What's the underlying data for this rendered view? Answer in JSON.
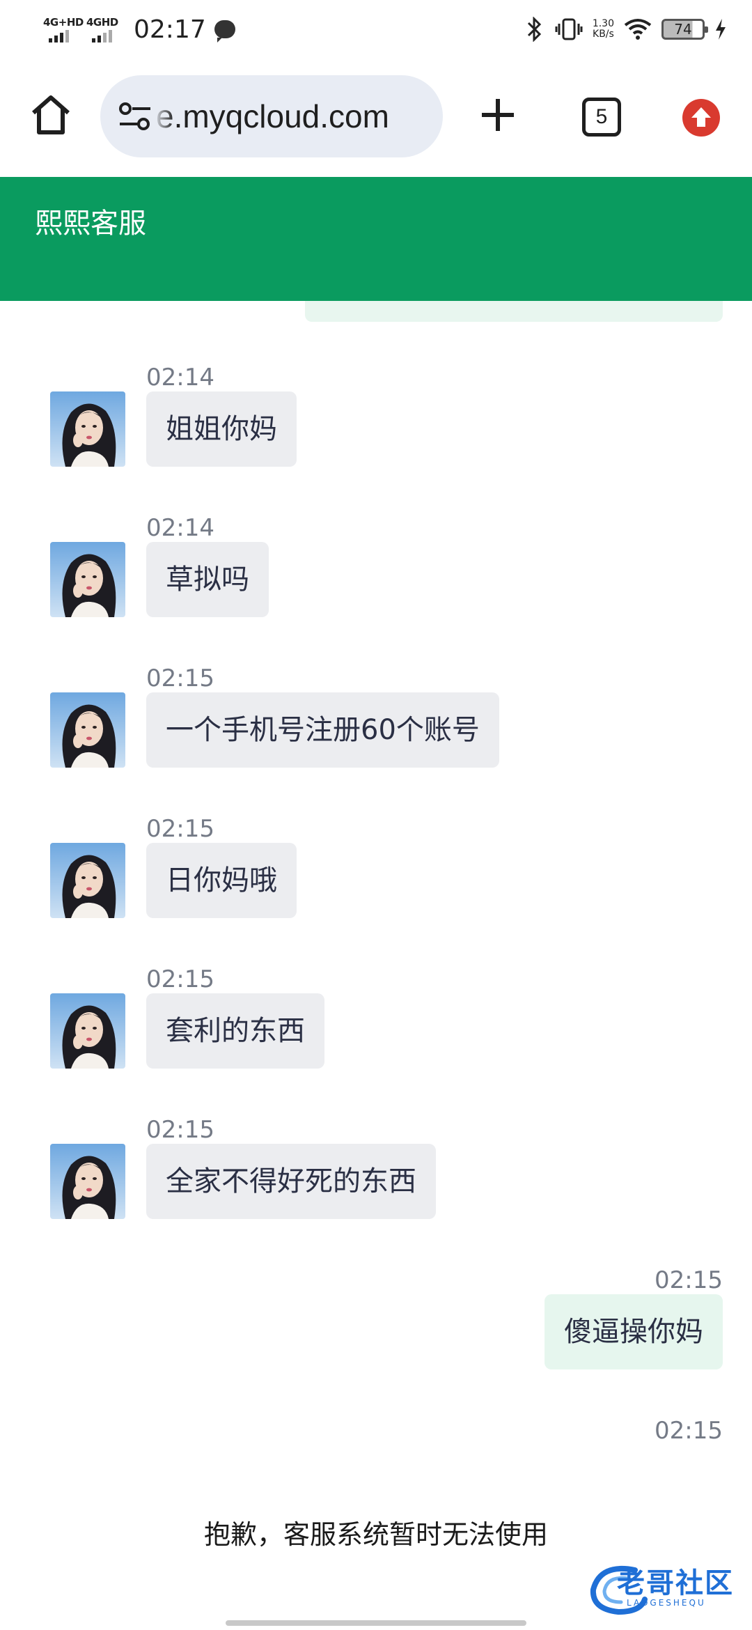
{
  "status_bar": {
    "net1": "4G+HD",
    "net2": "4GHD",
    "time": "02:17",
    "speed_value": "1.30",
    "speed_unit": "KB/s",
    "battery": "74"
  },
  "browser": {
    "url": "e.myqcloud.com",
    "tab_count": "5",
    "icons": {
      "home": "home-icon",
      "site_settings": "tune-icon",
      "new_tab": "plus-icon",
      "update": "arrow-up-icon"
    }
  },
  "header": {
    "title": "熙熙客服",
    "color": "#0a9b5f"
  },
  "messages": [
    {
      "time": "02:14",
      "text": "姐姐你妈",
      "from": "agent"
    },
    {
      "time": "02:14",
      "text": "草拟吗",
      "from": "agent"
    },
    {
      "time": "02:15",
      "text": "一个手机号注册60个账号",
      "from": "agent"
    },
    {
      "time": "02:15",
      "text": "日你妈哦",
      "from": "agent"
    },
    {
      "time": "02:15",
      "text": "套利的东西",
      "from": "agent"
    },
    {
      "time": "02:15",
      "text": "全家不得好死的东西",
      "from": "agent"
    },
    {
      "time": "02:15",
      "text": "傻逼操你妈",
      "from": "user"
    }
  ],
  "system": {
    "time": "02:15",
    "notice": "抱歉，客服系统暂时无法使用"
  },
  "watermark": {
    "text": "老哥社区",
    "sub": "LAOGESHEQU"
  }
}
